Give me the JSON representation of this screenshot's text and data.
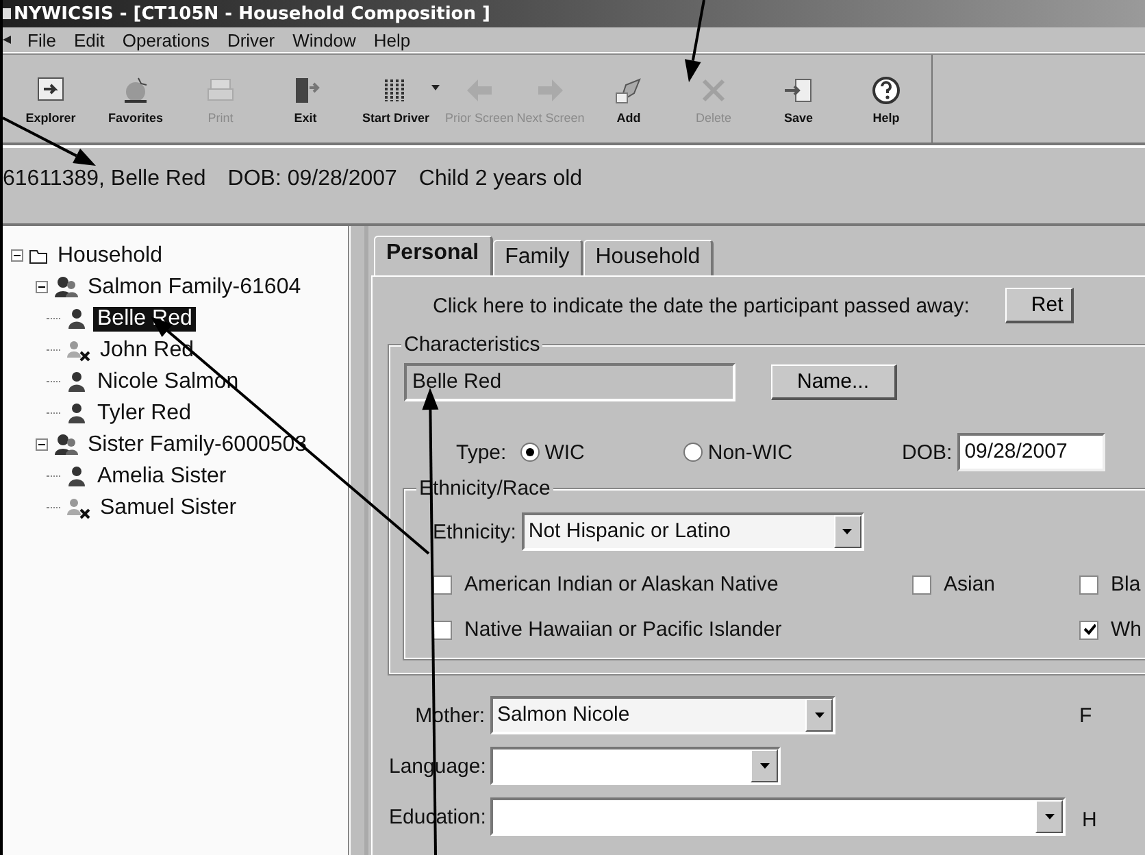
{
  "window": {
    "title": "NYWICSIS - [CT105N - Household Composition ]"
  },
  "menu": [
    "File",
    "Edit",
    "Operations",
    "Driver",
    "Window",
    "Help"
  ],
  "toolbar": [
    {
      "label": "Explorer",
      "kind": "explorer",
      "disabled": false
    },
    {
      "label": "Favorites",
      "kind": "favorites",
      "disabled": false
    },
    {
      "label": "Print",
      "kind": "print",
      "disabled": true
    },
    {
      "label": "Exit",
      "kind": "exit",
      "disabled": false
    },
    {
      "label": "Start Driver",
      "kind": "driver",
      "disabled": false,
      "dropdown": true
    },
    {
      "label": "Prior Screen",
      "kind": "prior",
      "disabled": true
    },
    {
      "label": "Next Screen",
      "kind": "next",
      "disabled": true
    },
    {
      "label": "Add",
      "kind": "add",
      "disabled": false
    },
    {
      "label": "Delete",
      "kind": "delete",
      "disabled": true
    },
    {
      "label": "Save",
      "kind": "save",
      "disabled": false
    },
    {
      "label": "Help",
      "kind": "help",
      "disabled": false
    }
  ],
  "header": {
    "id_name": "61611389, Belle Red",
    "dob": "DOB: 09/28/2007",
    "category": "Child 2 years old"
  },
  "tree": [
    {
      "label": "Household",
      "kind": "folder",
      "expanded": true,
      "children": [
        {
          "label": "Salmon Family-61604",
          "kind": "family",
          "expanded": true,
          "children": [
            {
              "label": "Belle Red",
              "kind": "person",
              "selected": true
            },
            {
              "label": "John Red",
              "kind": "person-removed",
              "selected": false
            },
            {
              "label": "Nicole Salmon",
              "kind": "person",
              "selected": false
            },
            {
              "label": "Tyler Red",
              "kind": "person",
              "selected": false
            }
          ]
        },
        {
          "label": "Sister Family-6000503",
          "kind": "family",
          "expanded": true,
          "children": [
            {
              "label": "Amelia Sister",
              "kind": "person",
              "selected": false
            },
            {
              "label": "Samuel Sister",
              "kind": "person-removed",
              "selected": false
            }
          ]
        }
      ]
    }
  ],
  "tabs": [
    {
      "label": "Personal",
      "selected": true
    },
    {
      "label": "Family",
      "selected": false
    },
    {
      "label": "Household",
      "selected": false
    }
  ],
  "deceased": {
    "prompt": "Click here to indicate the date the participant passed away:",
    "button": "Ret"
  },
  "characteristics": {
    "legend": "Characteristics",
    "name_value": "Belle Red",
    "name_button": "Name...",
    "type_label": "Type:",
    "types": [
      {
        "label": "WIC",
        "selected": true
      },
      {
        "label": "Non-WIC",
        "selected": false
      }
    ],
    "dob_label": "DOB:",
    "dob_value": "09/28/2007"
  },
  "ethnicity_race": {
    "legend": "Ethnicity/Race",
    "ethnicity_label": "Ethnicity:",
    "ethnicity_value": "Not Hispanic or Latino",
    "race_rows": [
      [
        {
          "label": "American Indian or Alaskan Native",
          "checked": false
        },
        {
          "label": "Asian",
          "checked": false
        },
        {
          "label": "Bla",
          "checked": false
        }
      ],
      [
        {
          "label": "Native Hawaiian or Pacific Islander",
          "checked": false
        },
        {
          "label": "Wh",
          "checked": true
        }
      ]
    ]
  },
  "fields": [
    {
      "label": "Mother:",
      "value": "Salmon Nicole",
      "side_label": "F"
    },
    {
      "label": "Language:"
    },
    {
      "label": "Education:",
      "side_label": "H"
    }
  ]
}
